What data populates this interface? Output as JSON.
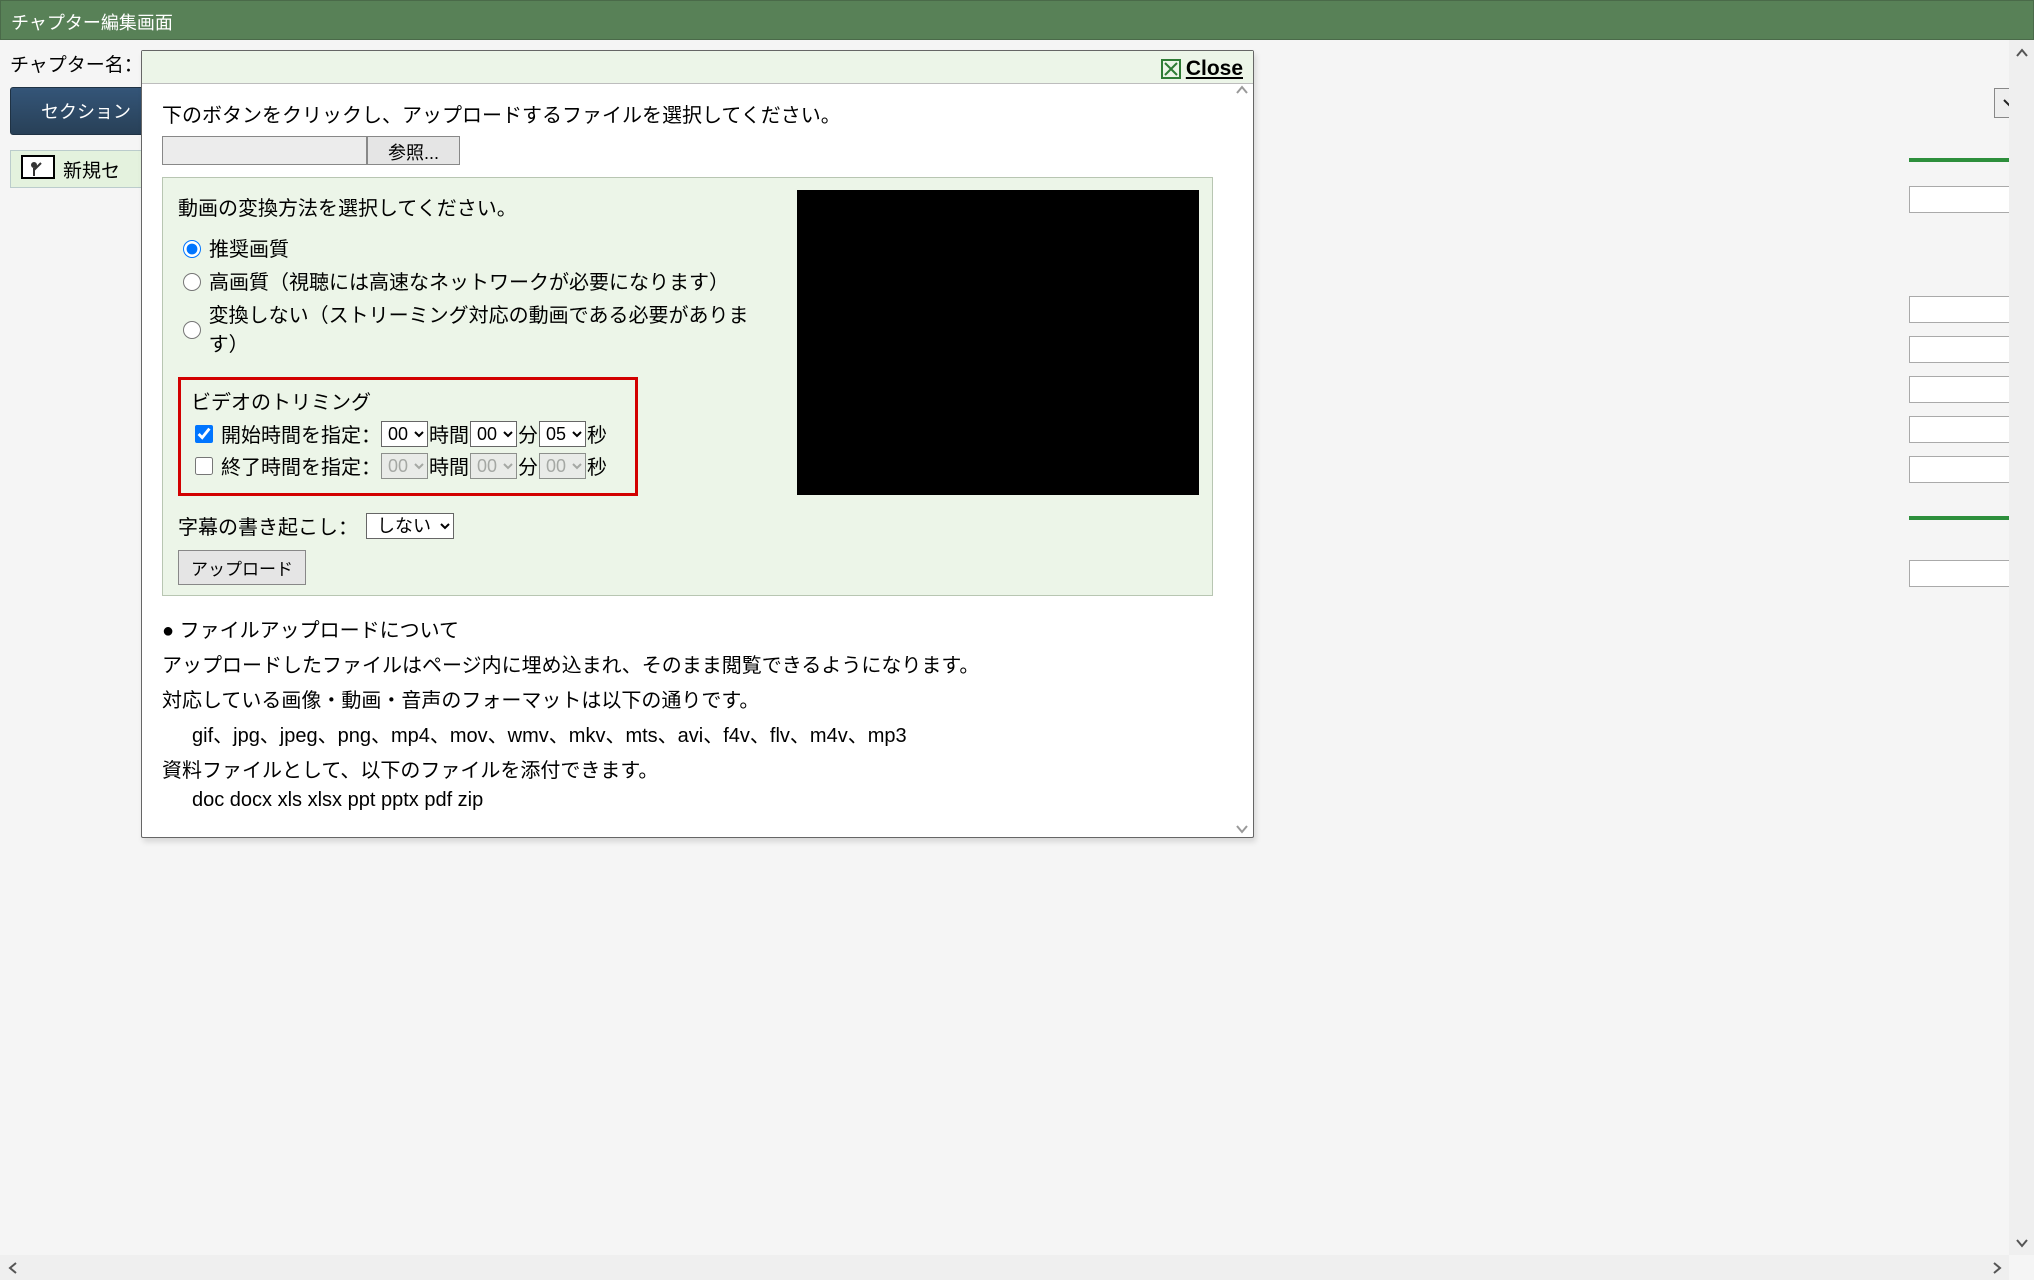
{
  "window": {
    "title": "チャプター編集画面",
    "chapter_name_label": "チャプター名：",
    "section_button": "セクション",
    "new_section": "新規セ"
  },
  "modal": {
    "close_label": "Close",
    "instruction": "下のボタンをクリックし、アップロードするファイルを選択してください。",
    "browse_label": "参照...",
    "panel": {
      "heading": "動画の変換方法を選択してください。",
      "radio_recommended": "推奨画質",
      "radio_highquality": "高画質（視聴には高速なネットワークが必要になります）",
      "radio_noconvert": "変換しない（ストリーミング対応の動画である必要があります）",
      "selected_radio": "recommended"
    },
    "trimming": {
      "title": "ビデオのトリミング",
      "start_checked": true,
      "start_label": "開始時間を指定：",
      "end_checked": false,
      "end_label": "終了時間を指定：",
      "unit_hour": "時間",
      "unit_min": "分",
      "unit_sec": "秒",
      "start_h": "00",
      "start_m": "00",
      "start_s": "05",
      "end_h": "00",
      "end_m": "00",
      "end_s": "00"
    },
    "caption": {
      "label": "字幕の書き起こし：",
      "value": "しない"
    },
    "upload_button": "アップロード",
    "info": {
      "heading": "● ファイルアップロードについて",
      "line1": "アップロードしたファイルはページ内に埋め込まれ、そのまま閲覧できるようになります。",
      "line2": "対応している画像・動画・音声のフォーマットは以下の通りです。",
      "formats": "gif、jpg、jpeg、png、mp4、mov、wmv、mkv、mts、avi、f4v、flv、m4v、mp3",
      "line3": "資料ファイルとして、以下のファイルを添付できます。",
      "docformats": "doc docx xls xlsx ppt pptx pdf zip"
    }
  }
}
